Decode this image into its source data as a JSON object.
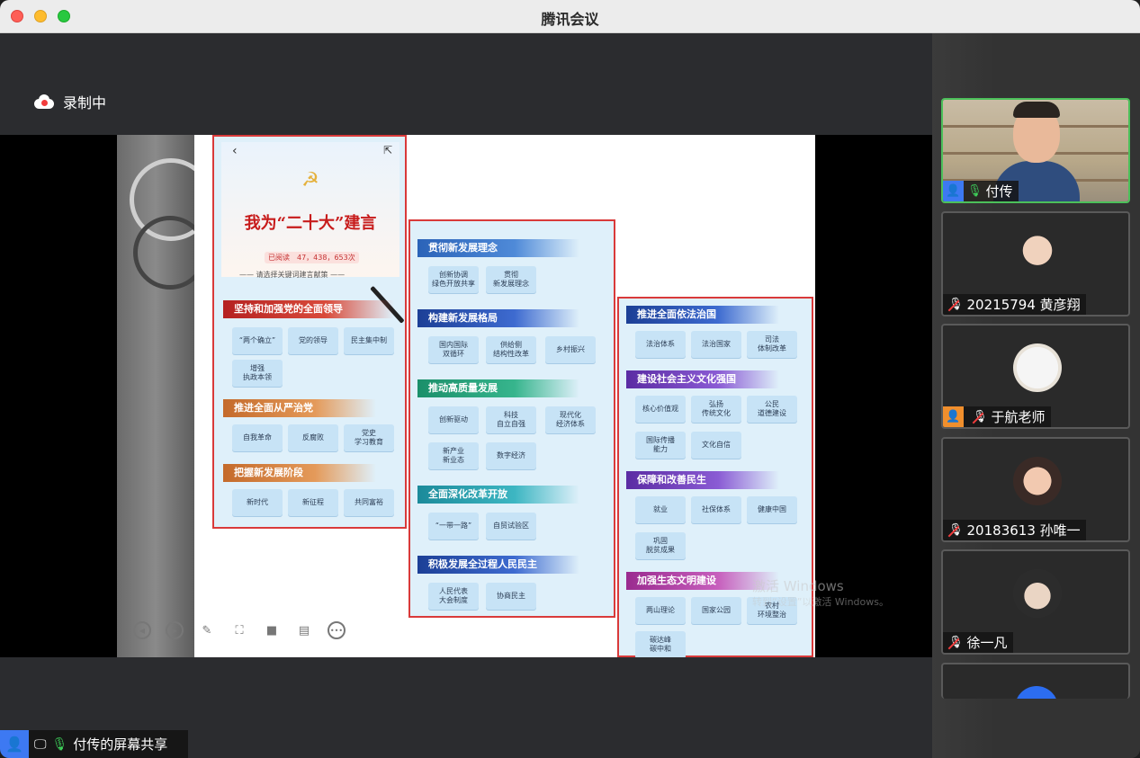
{
  "window": {
    "title": "腾讯会议"
  },
  "recording": {
    "label": "录制中"
  },
  "screen_share": {
    "label": "付传的屏幕共享",
    "slide": {
      "hero_title": "我为“二十大”建言",
      "reads": "已阅读　47，438，653次",
      "hint": "—— 请选择关键词建言献策 ——",
      "panel1": {
        "sections": [
          {
            "title": "坚持和加强党的全面领导",
            "chips": [
              "“两个确立”",
              "党的领导",
              "民主集中制",
              "增强\n执政本领"
            ]
          },
          {
            "title": "推进全面从严治党",
            "chips": [
              "自我革命",
              "反腐败",
              "党史\n学习教育"
            ]
          },
          {
            "title": "把握新发展阶段",
            "chips": [
              "新时代",
              "新征程",
              "共同富裕"
            ]
          }
        ]
      },
      "panel2": {
        "sections": [
          {
            "title": "贯彻新发展理念",
            "chips": [
              "创新协调\n绿色开放共享",
              "贯彻\n新发展理念"
            ]
          },
          {
            "title": "构建新发展格局",
            "chips": [
              "国内国际\n双循环",
              "供给侧\n结构性改革",
              "乡村振兴"
            ]
          },
          {
            "title": "推动高质量发展",
            "chips": [
              "创新驱动",
              "科技\n自立自强",
              "现代化\n经济体系",
              "新产业\n新业态",
              "数字经济"
            ]
          },
          {
            "title": "全面深化改革开放",
            "chips": [
              "“一带一路”",
              "自贸试验区"
            ]
          },
          {
            "title": "积极发展全过程人民民主",
            "chips": [
              "人民代表\n大会制度",
              "协商民主"
            ]
          }
        ]
      },
      "panel3": {
        "sections": [
          {
            "title": "推进全面依法治国",
            "chips": [
              "法治体系",
              "法治国家",
              "司法\n体制改革"
            ]
          },
          {
            "title": "建设社会主义文化强国",
            "chips": [
              "核心价值观",
              "弘扬\n传统文化",
              "公民\n道德建设",
              "国际传播\n能力",
              "文化自信"
            ]
          },
          {
            "title": "保障和改善民生",
            "chips": [
              "就业",
              "社保体系",
              "健康中国",
              "巩固\n脱贫成果"
            ]
          },
          {
            "title": "加强生态文明建设",
            "chips": [
              "两山理论",
              "国家公园",
              "农村\n环境整治",
              "碳达峰\n碳中和"
            ]
          }
        ]
      }
    },
    "toolbar": [
      "prev-icon",
      "next-icon",
      "pen-icon",
      "crop-icon",
      "camera-icon",
      "comment-icon",
      "more-icon"
    ],
    "watermark": {
      "line1": "激活 Windows",
      "line2": "转到“设置”以激活 Windows。"
    }
  },
  "participants": [
    {
      "name": "付传",
      "mic": "on",
      "speaking": true
    },
    {
      "name": "20215794 黄彦翔",
      "mic": "off"
    },
    {
      "name": "于航老师",
      "mic": "off"
    },
    {
      "name": "20183613 孙唯一",
      "mic": "off"
    },
    {
      "name": "徐一凡",
      "mic": "off"
    }
  ],
  "colors": {
    "active_border": "#4cc05a",
    "panel_border": "#d93a3a",
    "accent_blue": "#3d79f2"
  }
}
